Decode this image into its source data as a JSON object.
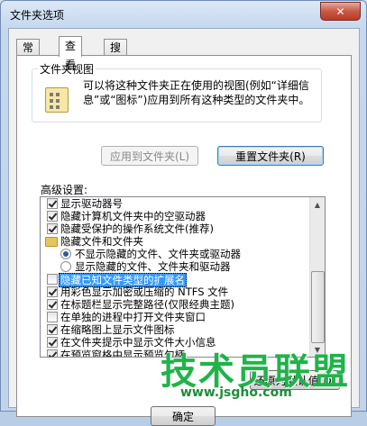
{
  "window": {
    "title": "文件夹选项",
    "close_label": "✕"
  },
  "tabs": [
    {
      "label": "常规"
    },
    {
      "label": "查看"
    },
    {
      "label": "搜索"
    }
  ],
  "folder_view": {
    "legend": "文件夹视图",
    "description": "可以将这种文件夹正在使用的视图(例如“详细信息”或“图标”)应用到所有这种类型的文件夹中。",
    "apply_button": "应用到文件夹(L)",
    "reset_button": "重置文件夹(R)"
  },
  "advanced": {
    "label": "高级设置:",
    "items": [
      {
        "type": "checkbox",
        "checked": true,
        "label": "显示驱动器号"
      },
      {
        "type": "checkbox",
        "checked": true,
        "label": "隐藏计算机文件夹中的空驱动器"
      },
      {
        "type": "checkbox",
        "checked": true,
        "label": "隐藏受保护的操作系统文件(推荐)"
      },
      {
        "type": "folder",
        "label": "隐藏文件和文件夹"
      },
      {
        "type": "radio",
        "checked": true,
        "label": "不显示隐藏的文件、文件夹或驱动器"
      },
      {
        "type": "radio",
        "checked": false,
        "label": "显示隐藏的文件、文件夹和驱动器"
      },
      {
        "type": "checkbox",
        "checked": false,
        "selected": true,
        "label": "隐藏已知文件类型的扩展名"
      },
      {
        "type": "checkbox",
        "checked": true,
        "label": "用彩色显示加密或压缩的 NTFS 文件"
      },
      {
        "type": "checkbox",
        "checked": true,
        "label": "在标题栏显示完整路径(仅限经典主题)"
      },
      {
        "type": "checkbox",
        "checked": false,
        "label": "在单独的进程中打开文件夹窗口"
      },
      {
        "type": "checkbox",
        "checked": true,
        "label": "在缩略图上显示文件图标"
      },
      {
        "type": "checkbox",
        "checked": true,
        "label": "在文件夹提示中显示文件大小信息"
      },
      {
        "type": "checkbox",
        "checked": true,
        "label": "在预览窗格中显示预览句柄"
      }
    ]
  },
  "restore_button": "还原为默认值(D)",
  "ok_button": "确定",
  "watermark": {
    "text": "技术员联盟",
    "url": "www.jsgho.com"
  }
}
